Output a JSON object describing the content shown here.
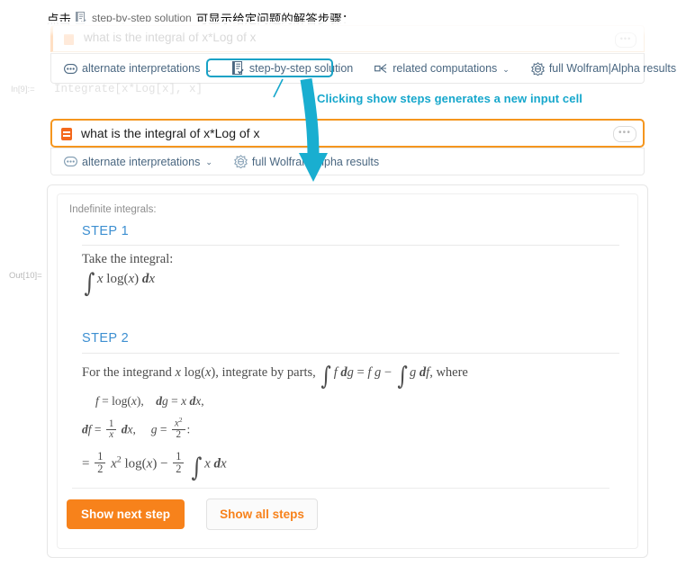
{
  "caption": {
    "prefix": "点击",
    "icon": "step-by-step-icon",
    "button_name": "step-by-step solution",
    "suffix": "可显示给定问题的解答步骤："
  },
  "faded_cell": {
    "text": "what is the integral of x*Log of x",
    "more_label": "•••",
    "icon": "wolfram-alpha-cell-icon"
  },
  "toolbar_top": {
    "items": [
      {
        "label": "alternate interpretations",
        "icon": "dots-bubble-icon",
        "caret": "⌄",
        "highlighted": false
      },
      {
        "label": "step-by-step solution",
        "icon": "steps-document-icon",
        "caret": "",
        "highlighted": true
      },
      {
        "label": "related computations",
        "icon": "related-nodes-icon",
        "caret": "⌄",
        "highlighted": false
      },
      {
        "label": "full Wolfram|Alpha results",
        "icon": "wolfram-spikey-icon",
        "caret": "",
        "highlighted": false
      }
    ]
  },
  "annotation": {
    "text": "Clicking show steps generates a new input cell",
    "color": "#16a7cc"
  },
  "in_label": "In[9]:=",
  "in_code_faded": "Integrate[x*Log[x], x]",
  "out_label": "Out[10]=",
  "input_cell": {
    "text": "what is the integral of x*Log of x",
    "more_label": "•••",
    "icon": "wolfram-alpha-cell-icon",
    "border_color": "#f5961e"
  },
  "toolbar_second": {
    "items": [
      {
        "label": "alternate interpretations",
        "icon": "dots-bubble-icon",
        "caret": "⌄"
      },
      {
        "label": "full Wolfram|Alpha results",
        "icon": "wolfram-spikey-icon",
        "caret": ""
      }
    ]
  },
  "result": {
    "title": "Indefinite integrals:",
    "steps": [
      {
        "heading": "STEP 1",
        "prose": "Take the integral:",
        "formula_plain": "∫ x log(x) dx"
      },
      {
        "heading": "STEP 2",
        "prose_1": "For the integrand",
        "prose_1_math": "x log(x)",
        "prose_2": ", integrate by parts,",
        "prose_2_math": "∫ f dg = f g − ∫ g df",
        "prose_3": ", where",
        "line_a": "f = log(x),     dg = x dx,",
        "line_b": "df = (1/x) dx,     g = x²/2 :",
        "line_c": "= (1/2) x² log(x) − (1/2) ∫ x dx"
      }
    ],
    "buttons": {
      "primary": "Show next step",
      "secondary": "Show all steps"
    }
  },
  "colors": {
    "accent_orange": "#f7821b",
    "cell_border_orange": "#f5961e",
    "annotation_teal": "#16a7cc",
    "step_heading_blue": "#3d8fd1",
    "toolbar_text": "#4a6781"
  }
}
